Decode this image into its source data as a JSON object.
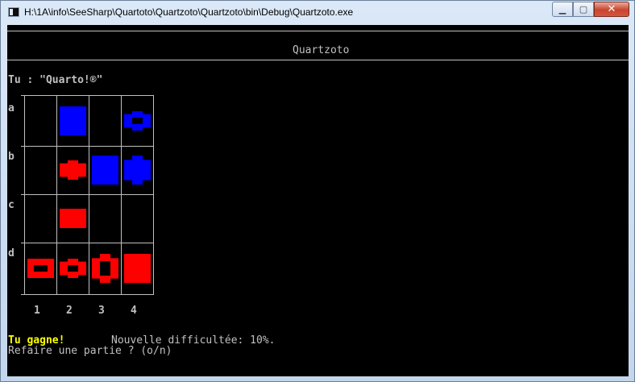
{
  "window": {
    "title": "H:\\1A\\info\\SeeSharp\\Quartoto\\Quartzoto\\Quartzoto\\bin\\Debug\\Quartzoto.exe",
    "minimize_icon": "minimize-icon",
    "maximize_icon": "maximize-icon",
    "close_icon": "close-icon"
  },
  "console": {
    "header_title": "Quartzoto",
    "player_line": "Tu : \"Quarto!®\"",
    "row_labels": [
      "a",
      "b",
      "c",
      "d"
    ],
    "col_labels": [
      "1",
      "2",
      "3",
      "4"
    ],
    "win_text": "Tu gagne!",
    "difficulty_text": "Nouvelle difficultée: 10%.",
    "replay_prompt": "Refaire une partie ? (o/n)",
    "colors": {
      "background": "#000000",
      "text": "#c0c0c0",
      "win": "#ffff00",
      "blue": "#0000ff",
      "red": "#ff0000"
    }
  },
  "board": {
    "pieces": [
      {
        "cell": "a2",
        "color": "blue",
        "shape": "square",
        "size": "tall",
        "fill": "solid"
      },
      {
        "cell": "a4",
        "color": "blue",
        "shape": "round",
        "size": "short",
        "fill": "hollow"
      },
      {
        "cell": "b2",
        "color": "red",
        "shape": "round",
        "size": "short",
        "fill": "solid"
      },
      {
        "cell": "b3",
        "color": "blue",
        "shape": "square",
        "size": "tall",
        "fill": "solid"
      },
      {
        "cell": "b4",
        "color": "blue",
        "shape": "round",
        "size": "tall",
        "fill": "solid"
      },
      {
        "cell": "c2",
        "color": "red",
        "shape": "square",
        "size": "short",
        "fill": "solid"
      },
      {
        "cell": "d1",
        "color": "red",
        "shape": "square",
        "size": "short",
        "fill": "hollow"
      },
      {
        "cell": "d2",
        "color": "red",
        "shape": "round",
        "size": "short",
        "fill": "hollow"
      },
      {
        "cell": "d3",
        "color": "red",
        "shape": "round",
        "size": "tall",
        "fill": "hollow"
      },
      {
        "cell": "d4",
        "color": "red",
        "shape": "square",
        "size": "tall",
        "fill": "solid"
      }
    ]
  }
}
